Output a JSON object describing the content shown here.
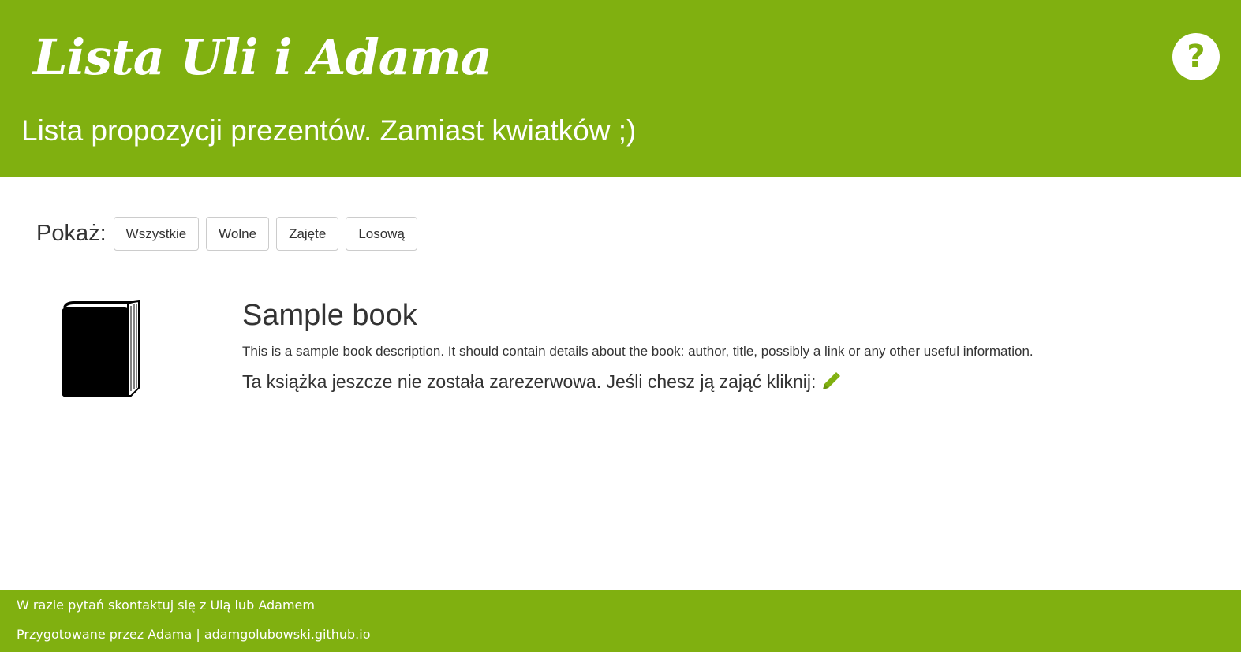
{
  "header": {
    "title": "Lista Uli i Adama",
    "subtitle": "Lista propozycji prezentów. Zamiast kwiatków ;)",
    "help_icon": "question-circle-icon",
    "help_glyph": "?"
  },
  "filters": {
    "label": "Pokaż:",
    "buttons": [
      "Wszystkie",
      "Wolne",
      "Zajęte",
      "Losową"
    ]
  },
  "book": {
    "title": "Sample book",
    "description": "This is a sample book description. It should contain details about the book: author, title, possibly a link or any other useful information.",
    "status": "Ta książka jeszcze nie została zarezerwowa. Jeśli chesz ją zająć kliknij:",
    "cover_icon": "book-icon",
    "reserve_icon": "pencil-icon"
  },
  "footer": {
    "line1": "W razie pytań skontaktuj się z Ulą lub Adamem",
    "line2": "Przygotowane przez Adama | adamgolubowski.github.io"
  },
  "colors": {
    "accent": "#80b010",
    "text": "#333333",
    "background": "#ffffff"
  }
}
